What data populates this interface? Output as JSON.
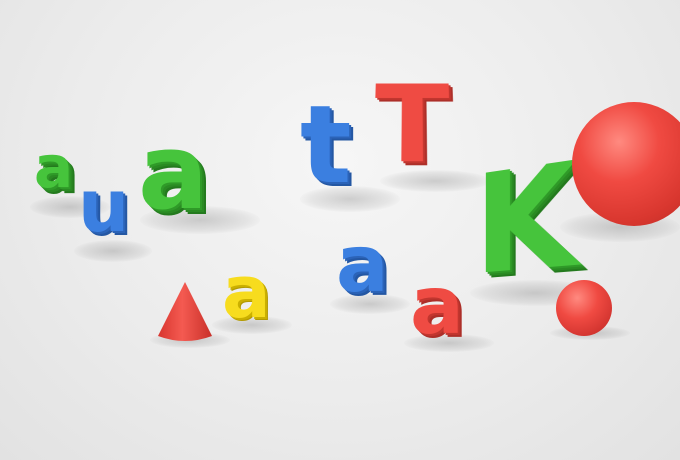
{
  "scene": {
    "letters": [
      {
        "id": "a1",
        "char": "a",
        "color": "green"
      },
      {
        "id": "u1",
        "char": "u",
        "color": "blue"
      },
      {
        "id": "a2",
        "char": "a",
        "color": "green"
      },
      {
        "id": "t1",
        "char": "t",
        "color": "blue"
      },
      {
        "id": "T1",
        "char": "T",
        "color": "red"
      },
      {
        "id": "K1",
        "char": "K",
        "color": "green"
      },
      {
        "id": "a3",
        "char": "a",
        "color": "yellow"
      },
      {
        "id": "a4",
        "char": "a",
        "color": "blue"
      },
      {
        "id": "a5",
        "char": "a",
        "color": "red"
      }
    ],
    "colors": {
      "green": "#46c43c",
      "blue": "#3b7fe0",
      "red": "#ef4b43",
      "yellow": "#f7dc1e",
      "background": "#ececec"
    }
  }
}
